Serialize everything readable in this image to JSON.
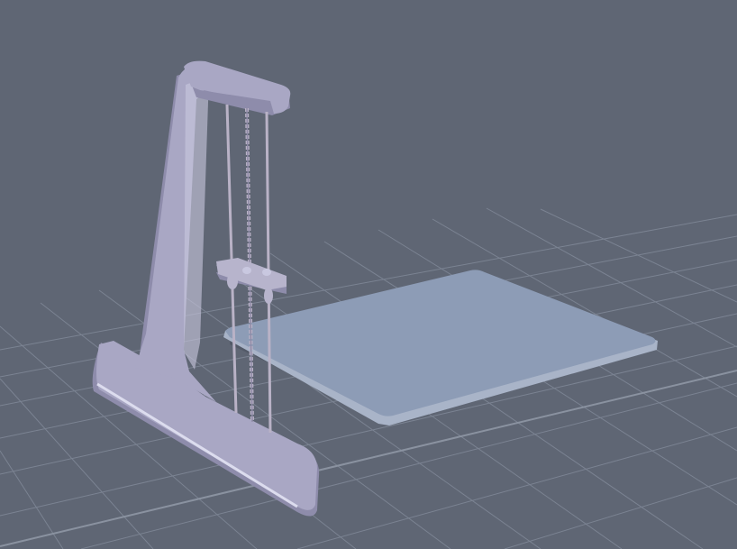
{
  "viewport": {
    "background_color": "#5f6674",
    "grid_color": "#7b8392",
    "grid_highlight_color": "#8a92a0"
  },
  "scene": {
    "frame_color": "#a9a7c4",
    "frame_shadow_color": "#8e8cab",
    "frame_highlight_color": "#c9c8e0",
    "frame_edge_color": "#dcdcee",
    "plate_color": "#8d9cb6",
    "plate_edge_color": "#a9b4c8",
    "rod_color": "#b9b2c6",
    "carriage_color": "#b7b4cc"
  }
}
